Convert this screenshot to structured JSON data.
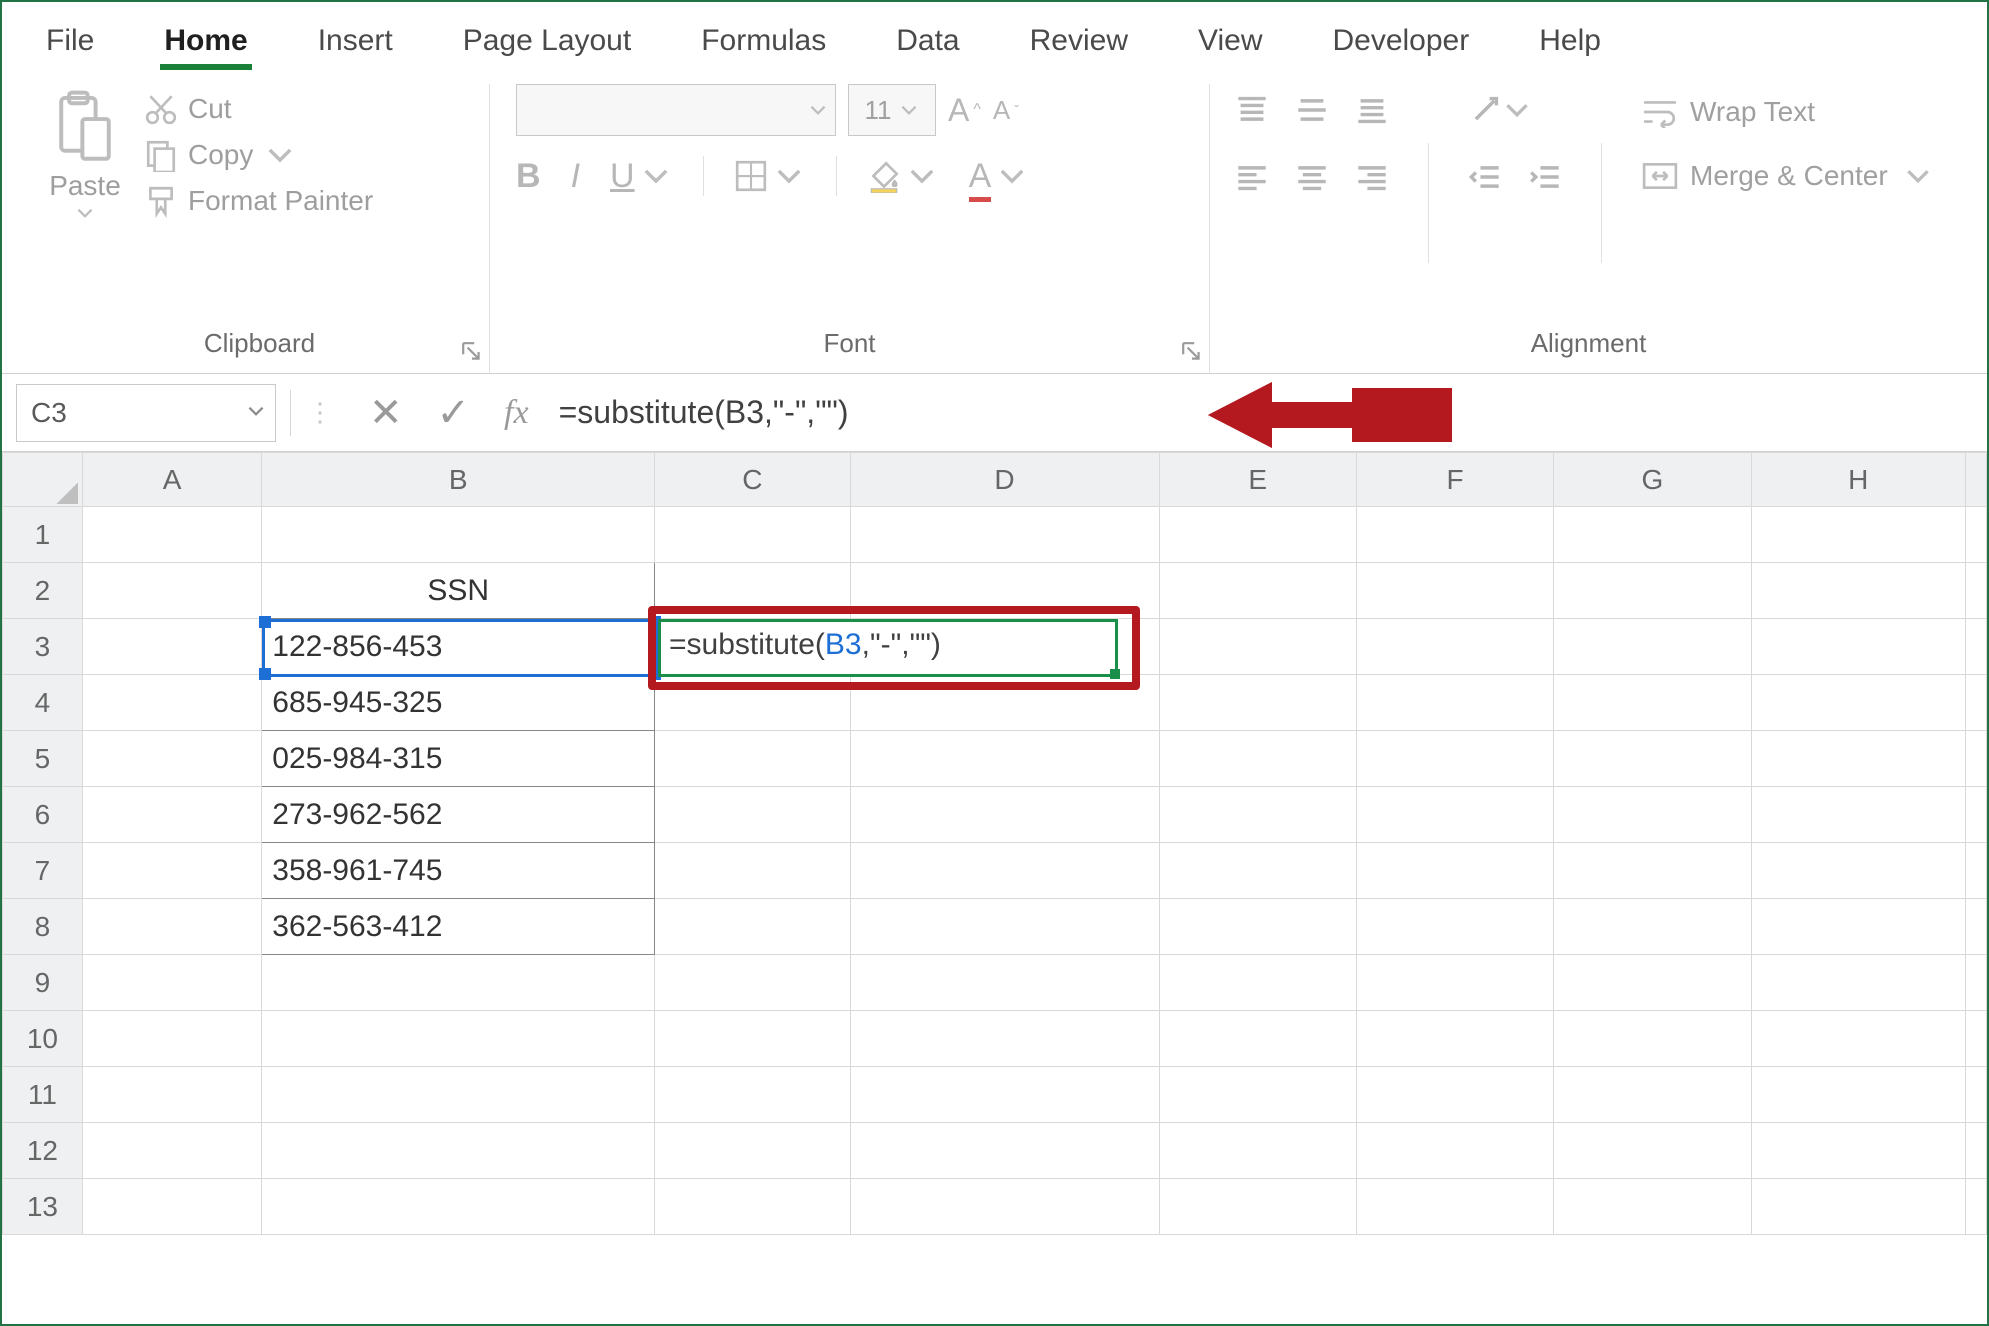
{
  "tabs": [
    "File",
    "Home",
    "Insert",
    "Page Layout",
    "Formulas",
    "Data",
    "Review",
    "View",
    "Developer",
    "Help"
  ],
  "active_tab": "Home",
  "clipboard": {
    "paste": "Paste",
    "cut": "Cut",
    "copy": "Copy",
    "format_painter": "Format Painter",
    "group_label": "Clipboard"
  },
  "font": {
    "size": "11",
    "group_label": "Font"
  },
  "alignment": {
    "wrap_text": "Wrap Text",
    "merge_center": "Merge & Center",
    "group_label": "Alignment"
  },
  "name_box": "C3",
  "formula_bar": "=substitute(B3,\"-\",\"\")",
  "columns": [
    "A",
    "B",
    "C",
    "D",
    "E",
    "F",
    "G",
    "H"
  ],
  "rows": [
    "1",
    "2",
    "3",
    "4",
    "5",
    "6",
    "7",
    "8",
    "9",
    "10",
    "11",
    "12",
    "13"
  ],
  "active_col": "C",
  "active_row": "3",
  "cells": {
    "B2": "SSN",
    "B3": "122-856-453",
    "B4": "685-945-325",
    "B5": "025-984-315",
    "B6": "273-962-562",
    "B7": "358-961-745",
    "B8": "362-563-412"
  },
  "edit_cell": {
    "prefix": "=substitute(",
    "ref": "B3",
    "suffix": ",\"-\",\"\")"
  },
  "colors": {
    "accent_green": "#1a7f37",
    "cell_edit_green": "#1a8f4a",
    "ref_blue": "#1d6fd6",
    "annotation_red": "#b3191e"
  }
}
